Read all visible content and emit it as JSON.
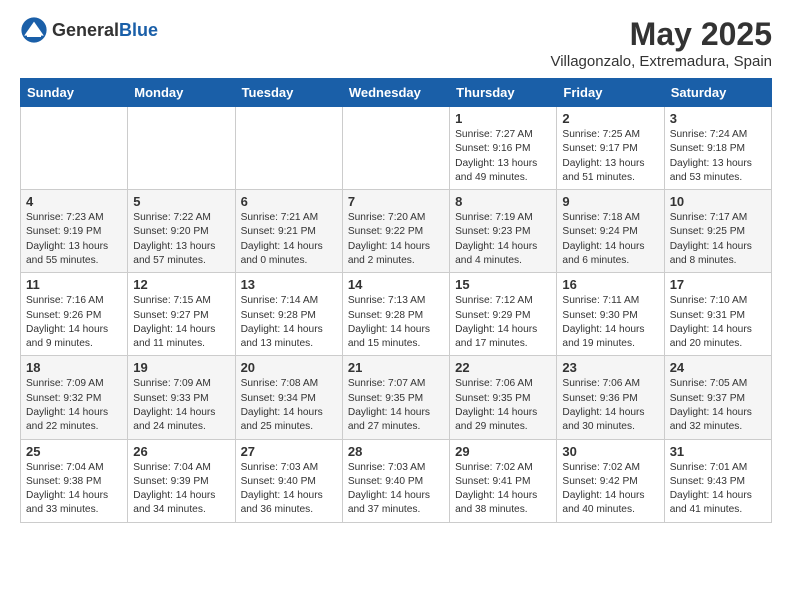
{
  "header": {
    "logo_general": "General",
    "logo_blue": "Blue",
    "title": "May 2025",
    "subtitle": "Villagonzalo, Extremadura, Spain"
  },
  "days_of_week": [
    "Sunday",
    "Monday",
    "Tuesday",
    "Wednesday",
    "Thursday",
    "Friday",
    "Saturday"
  ],
  "weeks": [
    [
      {
        "day": "",
        "info": ""
      },
      {
        "day": "",
        "info": ""
      },
      {
        "day": "",
        "info": ""
      },
      {
        "day": "",
        "info": ""
      },
      {
        "day": "1",
        "info": "Sunrise: 7:27 AM\nSunset: 9:16 PM\nDaylight: 13 hours\nand 49 minutes."
      },
      {
        "day": "2",
        "info": "Sunrise: 7:25 AM\nSunset: 9:17 PM\nDaylight: 13 hours\nand 51 minutes."
      },
      {
        "day": "3",
        "info": "Sunrise: 7:24 AM\nSunset: 9:18 PM\nDaylight: 13 hours\nand 53 minutes."
      }
    ],
    [
      {
        "day": "4",
        "info": "Sunrise: 7:23 AM\nSunset: 9:19 PM\nDaylight: 13 hours\nand 55 minutes."
      },
      {
        "day": "5",
        "info": "Sunrise: 7:22 AM\nSunset: 9:20 PM\nDaylight: 13 hours\nand 57 minutes."
      },
      {
        "day": "6",
        "info": "Sunrise: 7:21 AM\nSunset: 9:21 PM\nDaylight: 14 hours\nand 0 minutes."
      },
      {
        "day": "7",
        "info": "Sunrise: 7:20 AM\nSunset: 9:22 PM\nDaylight: 14 hours\nand 2 minutes."
      },
      {
        "day": "8",
        "info": "Sunrise: 7:19 AM\nSunset: 9:23 PM\nDaylight: 14 hours\nand 4 minutes."
      },
      {
        "day": "9",
        "info": "Sunrise: 7:18 AM\nSunset: 9:24 PM\nDaylight: 14 hours\nand 6 minutes."
      },
      {
        "day": "10",
        "info": "Sunrise: 7:17 AM\nSunset: 9:25 PM\nDaylight: 14 hours\nand 8 minutes."
      }
    ],
    [
      {
        "day": "11",
        "info": "Sunrise: 7:16 AM\nSunset: 9:26 PM\nDaylight: 14 hours\nand 9 minutes."
      },
      {
        "day": "12",
        "info": "Sunrise: 7:15 AM\nSunset: 9:27 PM\nDaylight: 14 hours\nand 11 minutes."
      },
      {
        "day": "13",
        "info": "Sunrise: 7:14 AM\nSunset: 9:28 PM\nDaylight: 14 hours\nand 13 minutes."
      },
      {
        "day": "14",
        "info": "Sunrise: 7:13 AM\nSunset: 9:28 PM\nDaylight: 14 hours\nand 15 minutes."
      },
      {
        "day": "15",
        "info": "Sunrise: 7:12 AM\nSunset: 9:29 PM\nDaylight: 14 hours\nand 17 minutes."
      },
      {
        "day": "16",
        "info": "Sunrise: 7:11 AM\nSunset: 9:30 PM\nDaylight: 14 hours\nand 19 minutes."
      },
      {
        "day": "17",
        "info": "Sunrise: 7:10 AM\nSunset: 9:31 PM\nDaylight: 14 hours\nand 20 minutes."
      }
    ],
    [
      {
        "day": "18",
        "info": "Sunrise: 7:09 AM\nSunset: 9:32 PM\nDaylight: 14 hours\nand 22 minutes."
      },
      {
        "day": "19",
        "info": "Sunrise: 7:09 AM\nSunset: 9:33 PM\nDaylight: 14 hours\nand 24 minutes."
      },
      {
        "day": "20",
        "info": "Sunrise: 7:08 AM\nSunset: 9:34 PM\nDaylight: 14 hours\nand 25 minutes."
      },
      {
        "day": "21",
        "info": "Sunrise: 7:07 AM\nSunset: 9:35 PM\nDaylight: 14 hours\nand 27 minutes."
      },
      {
        "day": "22",
        "info": "Sunrise: 7:06 AM\nSunset: 9:35 PM\nDaylight: 14 hours\nand 29 minutes."
      },
      {
        "day": "23",
        "info": "Sunrise: 7:06 AM\nSunset: 9:36 PM\nDaylight: 14 hours\nand 30 minutes."
      },
      {
        "day": "24",
        "info": "Sunrise: 7:05 AM\nSunset: 9:37 PM\nDaylight: 14 hours\nand 32 minutes."
      }
    ],
    [
      {
        "day": "25",
        "info": "Sunrise: 7:04 AM\nSunset: 9:38 PM\nDaylight: 14 hours\nand 33 minutes."
      },
      {
        "day": "26",
        "info": "Sunrise: 7:04 AM\nSunset: 9:39 PM\nDaylight: 14 hours\nand 34 minutes."
      },
      {
        "day": "27",
        "info": "Sunrise: 7:03 AM\nSunset: 9:40 PM\nDaylight: 14 hours\nand 36 minutes."
      },
      {
        "day": "28",
        "info": "Sunrise: 7:03 AM\nSunset: 9:40 PM\nDaylight: 14 hours\nand 37 minutes."
      },
      {
        "day": "29",
        "info": "Sunrise: 7:02 AM\nSunset: 9:41 PM\nDaylight: 14 hours\nand 38 minutes."
      },
      {
        "day": "30",
        "info": "Sunrise: 7:02 AM\nSunset: 9:42 PM\nDaylight: 14 hours\nand 40 minutes."
      },
      {
        "day": "31",
        "info": "Sunrise: 7:01 AM\nSunset: 9:43 PM\nDaylight: 14 hours\nand 41 minutes."
      }
    ]
  ]
}
